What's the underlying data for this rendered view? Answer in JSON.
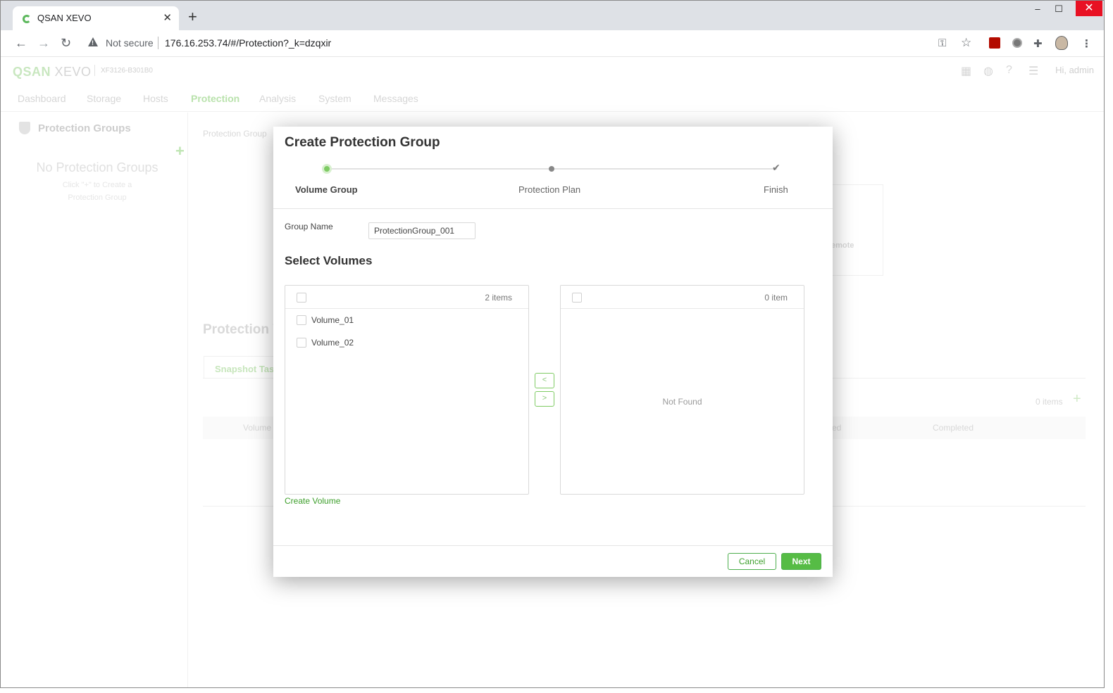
{
  "browser": {
    "tab_title": "QSAN XEVO",
    "tab_close": "✕",
    "new_tab": "+",
    "not_secure": "Not secure",
    "url": "176.16.253.74/#/Protection?_k=dzqxir",
    "window_controls": {
      "minimize": "–",
      "maximize": "☐",
      "close": "✕"
    },
    "icons": [
      "back-icon",
      "forward-icon",
      "reload-icon",
      "warning-icon",
      "key-icon",
      "star-icon",
      "pdf-extension-icon",
      "extension-round-icon",
      "puzzle-icon",
      "profile-avatar-icon",
      "menu-dots-icon"
    ]
  },
  "app": {
    "brand_main": "QSAN",
    "brand_sub": "XEVO",
    "model": "XF3126-B301B0",
    "greeting": "Hi, admin",
    "nav": [
      "Dashboard",
      "Storage",
      "Hosts",
      "Protection",
      "Analysis",
      "System",
      "Messages"
    ],
    "active_nav": "Protection",
    "sidebar": {
      "title": "Protection Groups",
      "empty_title": "No Protection Groups",
      "empty_hint_1": "Click \"+\" to Create a",
      "empty_hint_2": "Protection Group"
    },
    "background": {
      "breadcrumb": "Protection Group",
      "section_title": "Protection V",
      "tab": "Snapshot Tas",
      "count": "0 items",
      "col_volume": "Volume",
      "col_ed": "ed",
      "col_completed": "Completed",
      "card_text": "emote"
    },
    "colors": {
      "brand_green": "#56bc45",
      "link_green": "#3d9f2b",
      "step_active": "#7ecb63"
    }
  },
  "modal": {
    "title": "Create Protection Group",
    "steps": [
      {
        "label": "Volume Group",
        "state": "active"
      },
      {
        "label": "Protection Plan",
        "state": "todo"
      },
      {
        "label": "Finish",
        "state": "todo"
      }
    ],
    "group_name_label": "Group Name",
    "group_name_value": "ProtectionGroup_001",
    "select_volumes_title": "Select Volumes",
    "source": {
      "count": "2 items",
      "items": [
        "Volume_01",
        "Volume_02"
      ]
    },
    "target": {
      "count": "0 item",
      "empty_text": "Not Found"
    },
    "move_left": "<",
    "move_right": ">",
    "create_volume_link": "Create Volume",
    "cancel_label": "Cancel",
    "next_label": "Next"
  }
}
